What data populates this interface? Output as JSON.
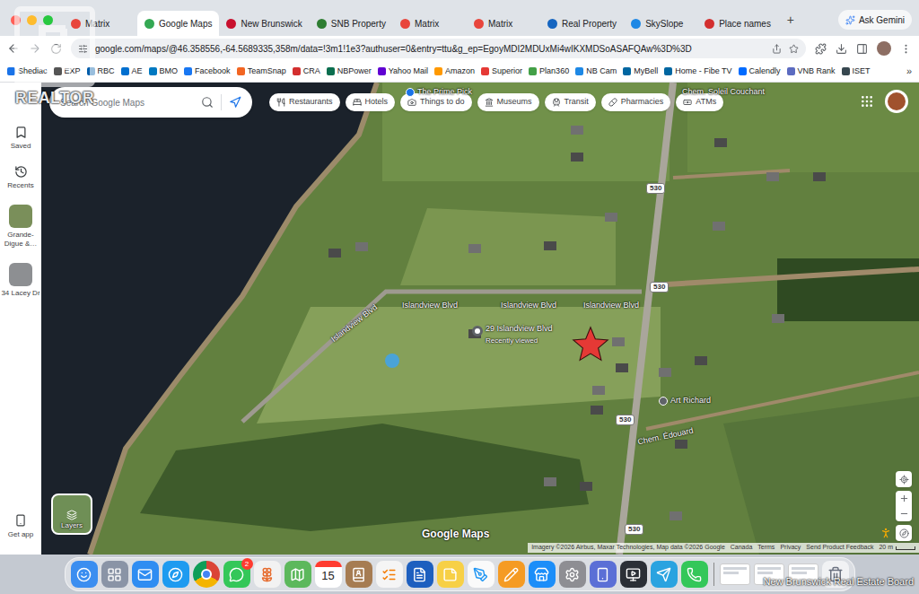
{
  "watermark": {
    "logo_text": "REALTOR",
    "board": "New Brunswick Real Estate Board"
  },
  "browser": {
    "tabs": [
      {
        "label": "Matrix",
        "selected": false
      },
      {
        "label": "Google Maps",
        "selected": true
      },
      {
        "label": "New Brunswick",
        "selected": false
      },
      {
        "label": "SNB Property",
        "selected": false
      },
      {
        "label": "Matrix",
        "selected": false
      },
      {
        "label": "Matrix",
        "selected": false
      },
      {
        "label": "Real Property",
        "selected": false
      },
      {
        "label": "SkySlope",
        "selected": false
      },
      {
        "label": "Place names",
        "selected": false
      }
    ],
    "new_tab": "+",
    "ask_button": "Ask Gemini",
    "url": "google.com/maps/@46.358556,-64.5689335,358m/data=!3m1!1e3?authuser=0&entry=ttu&g_ep=EgoyMDI2MDUxMi4wIKXMDSoASAFQAw%3D%3D",
    "bookmarks": [
      "Shediac",
      "EXP",
      "RBC",
      "AE",
      "BMO",
      "Facebook",
      "TeamSnap",
      "CRA",
      "NBPower",
      "Yahoo Mail",
      "Amazon",
      "Superior",
      "Plan360",
      "NB Cam",
      "MyBell",
      "Home - Fibe TV",
      "Calendly",
      "VNB Rank",
      "ISET"
    ],
    "bookmarks_more": "»"
  },
  "maps": {
    "search": {
      "placeholder": "Search Google Maps"
    },
    "chips": [
      "Restaurants",
      "Hotels",
      "Things to do",
      "Museums",
      "Transit",
      "Pharmacies",
      "ATMs"
    ],
    "sidebar": [
      {
        "label": "Saved",
        "kind": "icon"
      },
      {
        "label": "Recents",
        "kind": "icon"
      },
      {
        "label": "Grande-Digue &…",
        "kind": "thumbnail"
      },
      {
        "label": "34 Lacey Dr",
        "kind": "thumbnail"
      }
    ],
    "get_app": "Get app",
    "layers": "Layers",
    "labels": [
      {
        "text": "The Prime Pick",
        "kind": "poi"
      },
      {
        "text": "Chem. Soleil Couchant",
        "kind": "road"
      },
      {
        "text": "Islandview Blvd",
        "kind": "road"
      },
      {
        "text": "Islandview Blvd",
        "kind": "road"
      },
      {
        "text": "Islandview Blvd",
        "kind": "road"
      },
      {
        "text": "Islandview Blvd",
        "kind": "road"
      },
      {
        "text": "Art Richard",
        "kind": "business"
      },
      {
        "text": "Chem. Édouard",
        "kind": "road"
      }
    ],
    "route_shields": [
      "530",
      "530",
      "530",
      "530"
    ],
    "place": {
      "name": "29 Islandview Blvd",
      "note": "Recently viewed"
    },
    "logo": "Google Maps",
    "attribution": [
      "Imagery ©2026 Airbus, Maxar Technologies, Map data ©2026 Google",
      "Canada",
      "Terms",
      "Privacy",
      "Send Product Feedback"
    ],
    "scale": "20 m"
  },
  "dock": {
    "calendar_day": "15",
    "messages_badge": "2"
  }
}
